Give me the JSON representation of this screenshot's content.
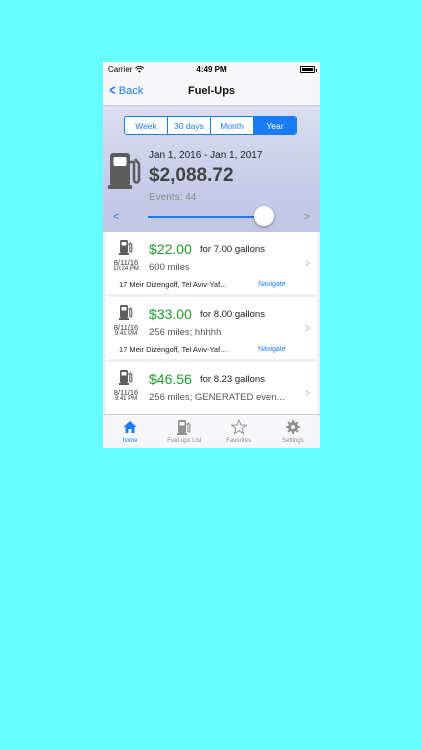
{
  "status": {
    "carrier": "Carrier",
    "time": "4:49 PM"
  },
  "nav": {
    "back_label": "Back",
    "title": "Fuel-Ups"
  },
  "segments": [
    {
      "label": "Week",
      "active": false
    },
    {
      "label": "30 days",
      "active": false
    },
    {
      "label": "Month",
      "active": false
    },
    {
      "label": "Year",
      "active": true
    }
  ],
  "summary": {
    "date_range": "Jan 1, 2016 - Jan 1, 2017",
    "total": "$2,088.72",
    "events": "Events: 44",
    "prev": "<",
    "next": ">"
  },
  "fuelups": [
    {
      "date": "8/11/16",
      "time": "10:24 PM",
      "amount": "$22.00",
      "gallons": "for 7.00 gallons",
      "miles": "600 miles",
      "address": "17 Meir Dizengoff, Tel Aviv-Yaf...",
      "navigate": "Navigate"
    },
    {
      "date": "8/11/16",
      "time": "9:41 PM",
      "amount": "$33.00",
      "gallons": "for 8.00 gallons",
      "miles": "256 miles;  hhhhh",
      "address": "17 Meir Dizengoff, Tel Aviv-Yaf...",
      "navigate": "Navigate"
    },
    {
      "date": "8/11/16",
      "time": "9:41 PM",
      "amount": "$46.56",
      "gallons": "for 8.23 gallons",
      "miles": "256 miles;  GENERATED even...",
      "address": "",
      "navigate": ""
    }
  ],
  "tabs": [
    {
      "label": "home",
      "icon": "house-icon",
      "active": true
    },
    {
      "label": "Fuel-ups List",
      "icon": "fuel-pump-icon",
      "active": false
    },
    {
      "label": "Favorites",
      "icon": "star-icon",
      "active": false
    },
    {
      "label": "Settings",
      "icon": "gear-icon",
      "active": false
    }
  ],
  "colors": {
    "accent": "#1a7cf5",
    "amount": "#1f9c2a",
    "background": "#67fdfd"
  }
}
